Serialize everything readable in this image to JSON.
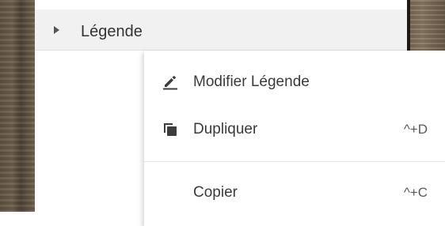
{
  "layer_tree": {
    "item_label": "Légende"
  },
  "context_menu": {
    "items": [
      {
        "label": "Modifier Légende",
        "shortcut": "",
        "icon": "pencil-icon"
      },
      {
        "label": "Dupliquer",
        "shortcut": "^+D",
        "icon": "duplicate-icon"
      },
      {
        "label": "Copier",
        "shortcut": "^+C",
        "icon": ""
      }
    ]
  },
  "colors": {
    "row_background": "#f1f1f2",
    "menu_background": "#ffffff",
    "text": "#3a3a3a",
    "icon": "#3c3c3c"
  }
}
